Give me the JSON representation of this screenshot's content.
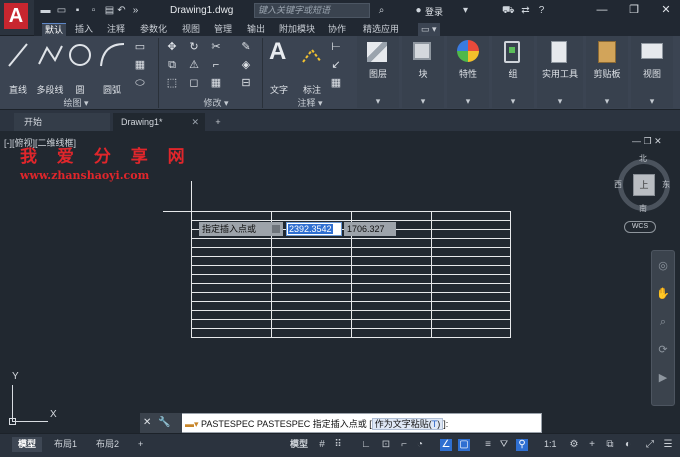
{
  "titlebar": {
    "doc_title": "Drawing1.dwg",
    "search_placeholder": "键入关键字或短语",
    "login": "登录"
  },
  "ribbon_tabs": [
    "默认",
    "插入",
    "注释",
    "参数化",
    "视图",
    "管理",
    "输出",
    "附加模块",
    "协作",
    "精选应用"
  ],
  "ribbon": {
    "draw_tools": [
      "直线",
      "多段线",
      "圆",
      "圆弧"
    ],
    "draw_panel": "绘图",
    "modify_panel": "修改",
    "annotate_tools": [
      "文字",
      "标注"
    ],
    "annotate_panel": "注释",
    "big_buttons": [
      "图层",
      "块",
      "特性",
      "组",
      "实用工具",
      "剪贴板",
      "视图"
    ]
  },
  "doc_tabs": {
    "start": "开始",
    "drawing": "Drawing1*",
    "add": "+"
  },
  "viewport": {
    "label": "[-][俯视][二维线框]",
    "controls": "— ❐ ✕"
  },
  "watermark": {
    "title": "我 爱 分 享 网",
    "url": "www.zhanshaoyi.com"
  },
  "dynamic_input": {
    "prompt": "指定插入点或",
    "x_value": "2392.3542",
    "y_value": "1706.327"
  },
  "table_grid": {
    "rows": 14,
    "cols": 4
  },
  "viewcube": {
    "north": "北",
    "south": "南",
    "east": "东",
    "west": "西",
    "top": "上",
    "wcs": "WCS"
  },
  "ucs": {
    "x": "X",
    "y": "Y"
  },
  "command": {
    "prefix": "PASTESPEC PASTESPEC 指定插入点或 [",
    "option_text": "作为文字粘贴(",
    "option_key": "T",
    "option_close": ")",
    "suffix": "]:"
  },
  "layout_tabs": [
    "模型",
    "布局1",
    "布局2"
  ],
  "statusbar": {
    "model": "模型",
    "scale": "1:1"
  },
  "colors": {
    "accent": "#2f6fd1",
    "canvas": "#212830",
    "watermark": "#e0262b"
  }
}
